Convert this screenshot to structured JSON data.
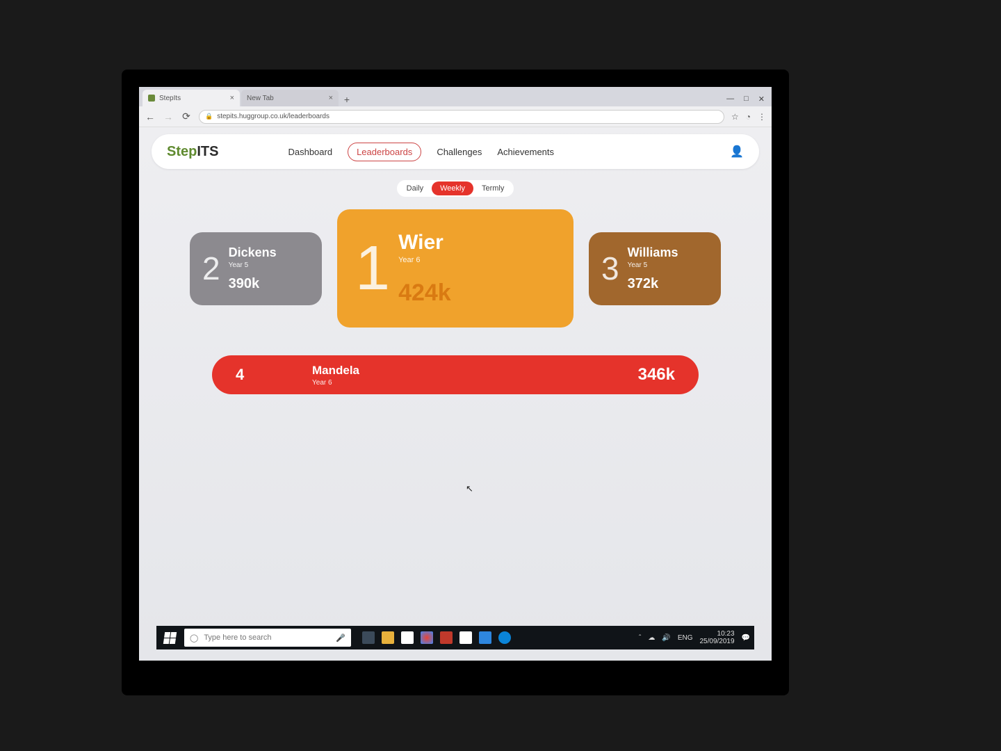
{
  "browser": {
    "tabs": [
      {
        "title": "StepIts"
      },
      {
        "title": "New Tab"
      }
    ],
    "url": "stepits.huggroup.co.uk/leaderboards",
    "window_controls": {
      "min": "—",
      "max": "□",
      "close": "✕"
    }
  },
  "logo": {
    "part1": "Step",
    "part2": "ITS"
  },
  "nav": {
    "items": [
      "Dashboard",
      "Leaderboards",
      "Challenges",
      "Achievements"
    ],
    "active": "Leaderboards"
  },
  "periods": {
    "items": [
      "Daily",
      "Weekly",
      "Termly"
    ],
    "active": "Weekly"
  },
  "podium": {
    "first": {
      "rank": "1",
      "name": "Wier",
      "year": "Year 6",
      "score": "424k"
    },
    "second": {
      "rank": "2",
      "name": "Dickens",
      "year": "Year 5",
      "score": "390k"
    },
    "third": {
      "rank": "3",
      "name": "Williams",
      "year": "Year 5",
      "score": "372k"
    }
  },
  "rows": [
    {
      "rank": "4",
      "name": "Mandela",
      "year": "Year 6",
      "score": "346k"
    }
  ],
  "taskbar": {
    "search_placeholder": "Type here to search",
    "lang": "ENG",
    "time": "10:23",
    "date": "25/09/2019"
  },
  "colors": {
    "brand_green": "#5f8a2f",
    "accent_red": "#e5332b",
    "gold": "#f0a22c",
    "silver": "#8c8a8f",
    "bronze": "#a1672d"
  }
}
